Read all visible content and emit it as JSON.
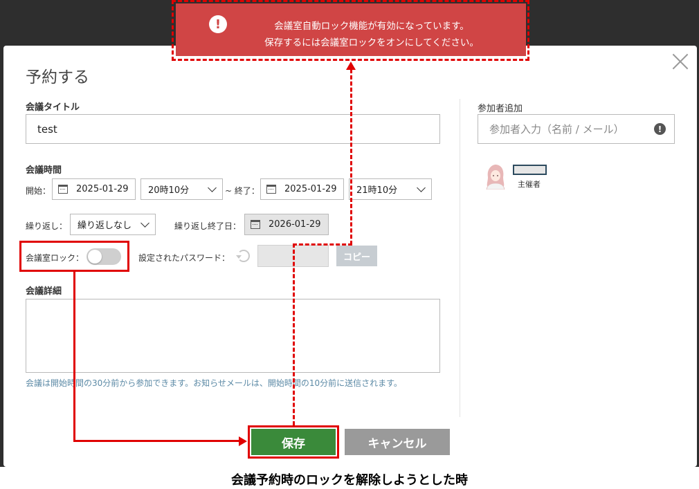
{
  "modal": {
    "title": "予約する",
    "meeting_title_label": "会議タイトル",
    "meeting_title_value": "test",
    "meeting_time_label": "会議時間",
    "start_label": "開始：",
    "start_date": "2025-01-29",
    "start_time": "20時10分",
    "end_label": "~ 終了：",
    "end_date": "2025-01-29",
    "end_time": "21時10分",
    "repeat_label": "繰り返し：",
    "repeat_value": "繰り返しなし",
    "repeat_end_label": "繰り返し終了日：",
    "repeat_end_date": "2026-01-29",
    "room_lock_label": "会議室ロック：",
    "room_lock_on": false,
    "password_label": "設定されたパスワード：",
    "copy_button": "コピー",
    "details_label": "会議詳細",
    "note": "会議は開始時間の30分前から参加できます。お知らせメールは、開始時間の10分前に送信されます。",
    "participants_label": "参加者追加",
    "participants_placeholder": "参加者入力（名前 / メール）",
    "organizer_role": "主催者",
    "save_button": "保存",
    "cancel_button": "キャンセル"
  },
  "toast": {
    "line1": "会議室自動ロック機能が有効になっています。",
    "line2": "保存するには会議室ロックをオンにしてください。"
  },
  "caption": "会議予約時のロックを解除しようとした時",
  "colors": {
    "toast_bg": "#d04545",
    "save_green": "#3a8a3a",
    "annotation_red": "#e00000"
  }
}
